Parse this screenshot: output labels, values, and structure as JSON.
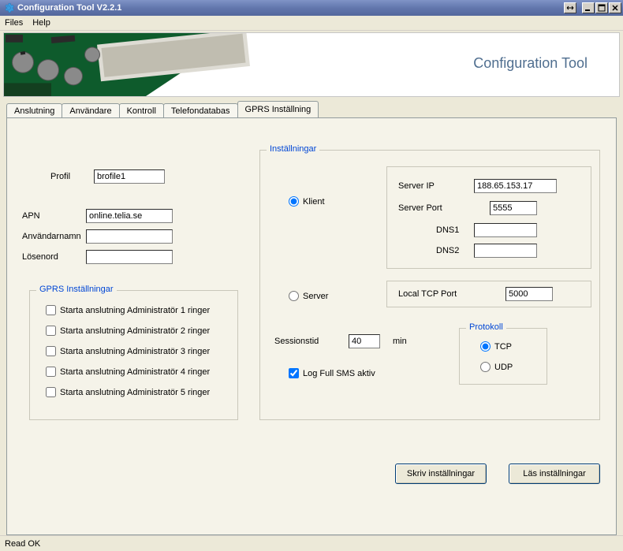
{
  "window": {
    "title": "Configuration Tool  V2.2.1"
  },
  "menu": {
    "files": "Files",
    "help": "Help"
  },
  "banner": {
    "brand": "Configuration Tool"
  },
  "tabs": {
    "anslutning": "Anslutning",
    "anvandare": "Användare",
    "kontroll": "Kontroll",
    "telefondatabas": "Telefondatabas",
    "gprs": "GPRS Inställning"
  },
  "left": {
    "profil_label": "Profil",
    "profil_value": "brofile1",
    "apn_label": "APN",
    "apn_value": "online.telia.se",
    "user_label": "Användarnamn",
    "user_value": "",
    "pass_label": "Lösenord",
    "pass_value": ""
  },
  "gprs_group": {
    "legend": "GPRS Inställningar",
    "items": [
      "Starta anslutning Administratör 1 ringer",
      "Starta anslutning Administratör 2 ringer",
      "Starta anslutning Administratör 3 ringer",
      "Starta anslutning Administratör 4 ringer",
      "Starta anslutning Administratör 5 ringer"
    ]
  },
  "settings": {
    "legend": "Inställningar",
    "klient": "Klient",
    "server": "Server",
    "server_ip_label": "Server IP",
    "server_ip_value": "188.65.153.17",
    "server_port_label": "Server Port",
    "server_port_value": "5555",
    "dns1_label": "DNS1",
    "dns1_value": "",
    "dns2_label": "DNS2",
    "dns2_value": "",
    "local_tcp_label": "Local TCP Port",
    "local_tcp_value": "5000",
    "sessionstid_label": "Sessionstid",
    "sessionstid_value": "40",
    "sessionstid_unit": "min",
    "log_sms_label": "Log Full SMS aktiv",
    "protokoll_legend": "Protokoll",
    "tcp": "TCP",
    "udp": "UDP"
  },
  "buttons": {
    "write": "Skriv inställningar",
    "read": "Läs inställningar"
  },
  "status": {
    "text": "Read OK"
  }
}
